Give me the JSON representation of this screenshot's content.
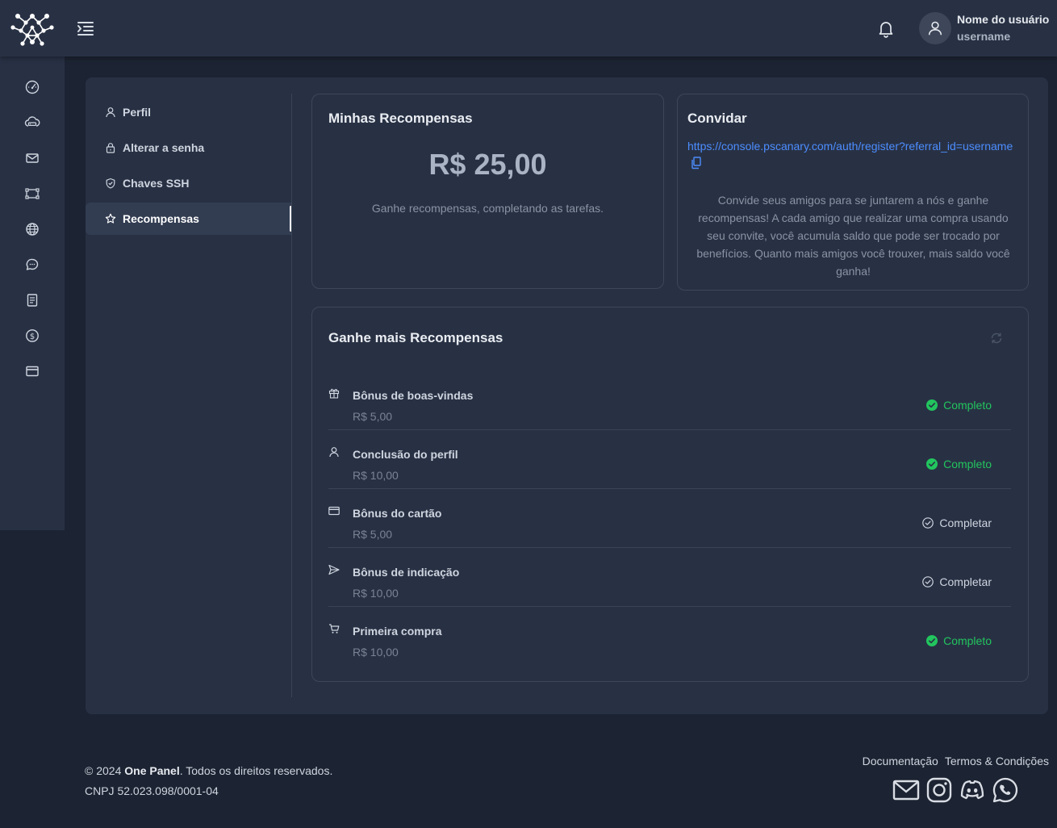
{
  "header": {
    "user_name": "Nome do usuário",
    "username": "username"
  },
  "sidebar": {
    "icons": [
      "dashboard-icon",
      "cloud-server-icon",
      "mail-icon",
      "nodes-icon",
      "globe-icon",
      "chat-icon",
      "document-icon",
      "dollar-icon",
      "credit-card-icon"
    ]
  },
  "settings_nav": {
    "items": [
      {
        "label": "Perfil",
        "icon": "user-icon"
      },
      {
        "label": "Alterar a senha",
        "icon": "lock-icon"
      },
      {
        "label": "Chaves SSH",
        "icon": "shield-icon"
      },
      {
        "label": "Recompensas",
        "icon": "star-icon",
        "active": true
      }
    ]
  },
  "rewards": {
    "title": "Minhas Recompensas",
    "amount": "R$ 25,00",
    "hint": "Ganhe recompensas, completando as tarefas."
  },
  "invite": {
    "title": "Convidar",
    "link": "https://console.pscanary.com/auth/register?referral_id=username",
    "text": "Convide seus amigos para se juntarem a nós e ganhe recompensas! A cada amigo que realizar uma compra usando seu convite, você acumula saldo que pode ser trocado por benefícios. Quanto mais amigos você trouxer, mais saldo você ganha!"
  },
  "earn": {
    "title": "Ganhe mais Recompensas",
    "tasks": [
      {
        "name": "Bônus de boas-vindas",
        "value": "R$ 5,00",
        "status": "Completo",
        "done": true,
        "icon": "gift-icon"
      },
      {
        "name": "Conclusão do perfil",
        "value": "R$ 10,00",
        "status": "Completo",
        "done": true,
        "icon": "user-icon"
      },
      {
        "name": "Bônus do cartão",
        "value": "R$ 5,00",
        "status": "Completar",
        "done": false,
        "icon": "credit-card-icon"
      },
      {
        "name": "Bônus de indicação",
        "value": "R$ 10,00",
        "status": "Completar",
        "done": false,
        "icon": "send-icon"
      },
      {
        "name": "Primeira compra",
        "value": "R$ 10,00",
        "status": "Completo",
        "done": true,
        "icon": "cart-icon"
      }
    ]
  },
  "footer": {
    "copy_prefix": "© 2024 ",
    "brand": "One Panel",
    "copy_suffix": ". Todos os direitos reservados.",
    "cnpj": "CNPJ 52.023.098/0001-04",
    "links": [
      "Documentação",
      "Termos & Condições"
    ],
    "social": [
      "mail-icon",
      "instagram-icon",
      "discord-icon",
      "whatsapp-icon"
    ]
  },
  "colors": {
    "background": "#1c2332",
    "surface": "#283144",
    "success": "#22c55e",
    "link": "#4c8dff"
  }
}
